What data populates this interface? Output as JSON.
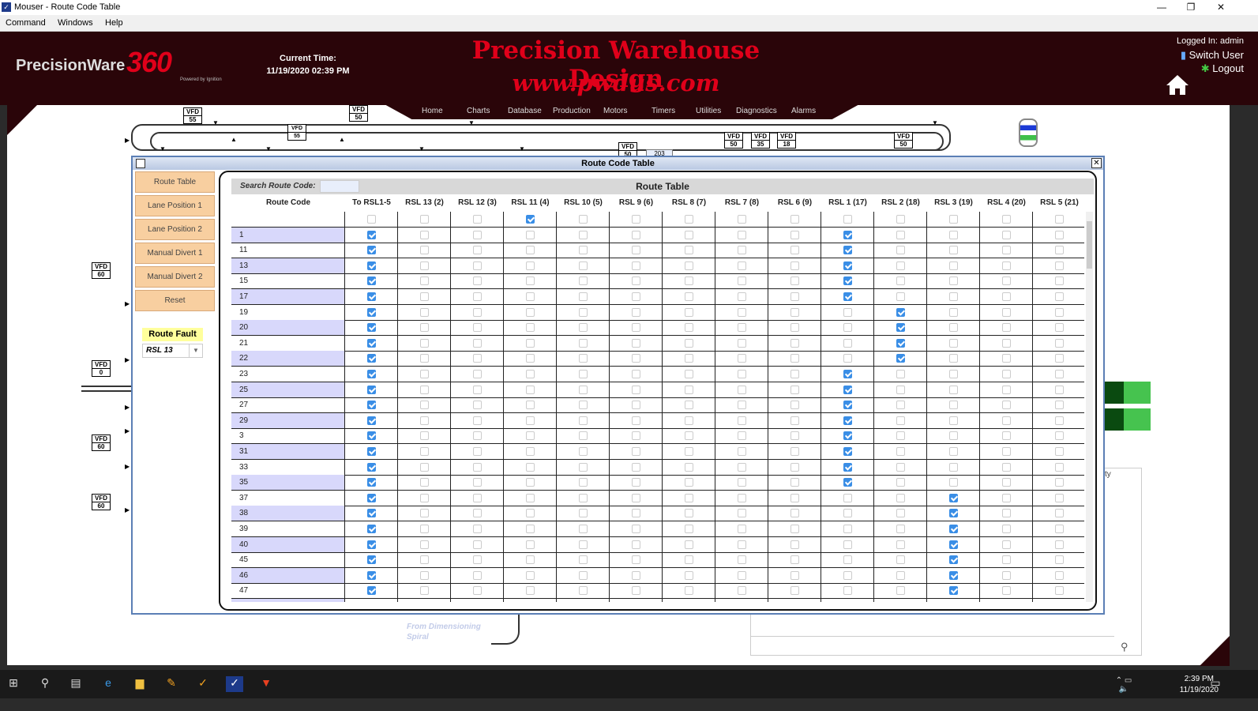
{
  "window": {
    "title": "Mouser - Route Code Table",
    "minimize": "—",
    "restore": "❐",
    "close": "✕"
  },
  "menu": [
    "Command",
    "Windows",
    "Help"
  ],
  "header": {
    "logo_text": "PrecisionWare",
    "logo_num": "360",
    "powered": "Powered by Ignition",
    "time_label": "Current Time:",
    "time_value": "11/19/2020 02:39 PM",
    "brand": "Precision Warehouse Design",
    "site": "www.pwdus.com",
    "logged_in": "Logged In: admin",
    "switch_user": "Switch User",
    "logout": "Logout"
  },
  "nav": [
    "Home",
    "Charts",
    "Database",
    "Production",
    "Motors",
    "Timers",
    "Utilities",
    "Diagnostics",
    "Alarms"
  ],
  "vfds": [
    {
      "label": "VFD",
      "value": "55"
    },
    {
      "label": "VFD",
      "value": "50"
    },
    {
      "label": "VFD",
      "value": "55"
    },
    {
      "label": "VFD",
      "value": "50"
    },
    {
      "label": "VFD",
      "value": "35"
    },
    {
      "label": "VFD",
      "value": "18"
    },
    {
      "label": "VFD",
      "value": "50"
    },
    {
      "label": "VFD",
      "value": "50"
    },
    {
      "label": "VFD",
      "value": "60"
    },
    {
      "label": "VFD",
      "value": "0"
    },
    {
      "label": "VFD",
      "value": "60"
    },
    {
      "label": "VFD",
      "value": "60"
    }
  ],
  "conveyor_value": "203",
  "modal": {
    "title": "Route Code Table",
    "close": "✕"
  },
  "sidebar": {
    "buttons": [
      "Route Table",
      "Lane Position 1",
      "Lane Position 2",
      "Manual Divert 1",
      "Manual Divert 2",
      "Reset"
    ],
    "fault_label": "Route Fault",
    "fault_value": "RSL 13"
  },
  "table": {
    "search_label": "Search Route Code:",
    "search_value": "",
    "title": "Route Table",
    "columns": [
      "Route Code",
      "To RSL1-5",
      "RSL 13 (2)",
      "RSL 12 (3)",
      "RSL 11 (4)",
      "RSL 10 (5)",
      "RSL 9 (6)",
      "RSL 8 (7)",
      "RSL 7 (8)",
      "RSL 6 (9)",
      "RSL 1 (17)",
      "RSL 2 (18)",
      "RSL 3 (19)",
      "RSL 4 (20)",
      "RSL 5 (21)"
    ],
    "rows": [
      {
        "code": "",
        "checked": [
          3
        ]
      },
      {
        "code": "1",
        "checked": [
          0,
          9
        ]
      },
      {
        "code": "11",
        "checked": [
          0,
          9
        ]
      },
      {
        "code": "13",
        "checked": [
          0,
          9
        ]
      },
      {
        "code": "15",
        "checked": [
          0,
          9
        ]
      },
      {
        "code": "17",
        "checked": [
          0,
          9
        ]
      },
      {
        "code": "19",
        "checked": [
          0,
          10
        ]
      },
      {
        "code": "20",
        "checked": [
          0,
          10
        ]
      },
      {
        "code": "21",
        "checked": [
          0,
          10
        ]
      },
      {
        "code": "22",
        "checked": [
          0,
          10
        ]
      },
      {
        "code": "23",
        "checked": [
          0,
          9
        ]
      },
      {
        "code": "25",
        "checked": [
          0,
          9
        ]
      },
      {
        "code": "27",
        "checked": [
          0,
          9
        ]
      },
      {
        "code": "29",
        "checked": [
          0,
          9
        ]
      },
      {
        "code": "3",
        "checked": [
          0,
          9
        ]
      },
      {
        "code": "31",
        "checked": [
          0,
          9
        ]
      },
      {
        "code": "33",
        "checked": [
          0,
          9
        ]
      },
      {
        "code": "35",
        "checked": [
          0,
          9
        ]
      },
      {
        "code": "37",
        "checked": [
          0,
          11
        ]
      },
      {
        "code": "38",
        "checked": [
          0,
          11
        ]
      },
      {
        "code": "39",
        "checked": [
          0,
          11
        ]
      },
      {
        "code": "40",
        "checked": [
          0,
          11
        ]
      },
      {
        "code": "45",
        "checked": [
          0,
          11
        ]
      },
      {
        "code": "46",
        "checked": [
          0,
          11
        ]
      },
      {
        "code": "47",
        "checked": [
          0,
          11
        ]
      },
      {
        "code": "",
        "checked": [
          0,
          11
        ]
      }
    ]
  },
  "from_label": "From Dimensioning Spiral",
  "right_panel_text": "ty",
  "taskbar": {
    "time": "2:39 PM",
    "date": "11/19/2020"
  }
}
